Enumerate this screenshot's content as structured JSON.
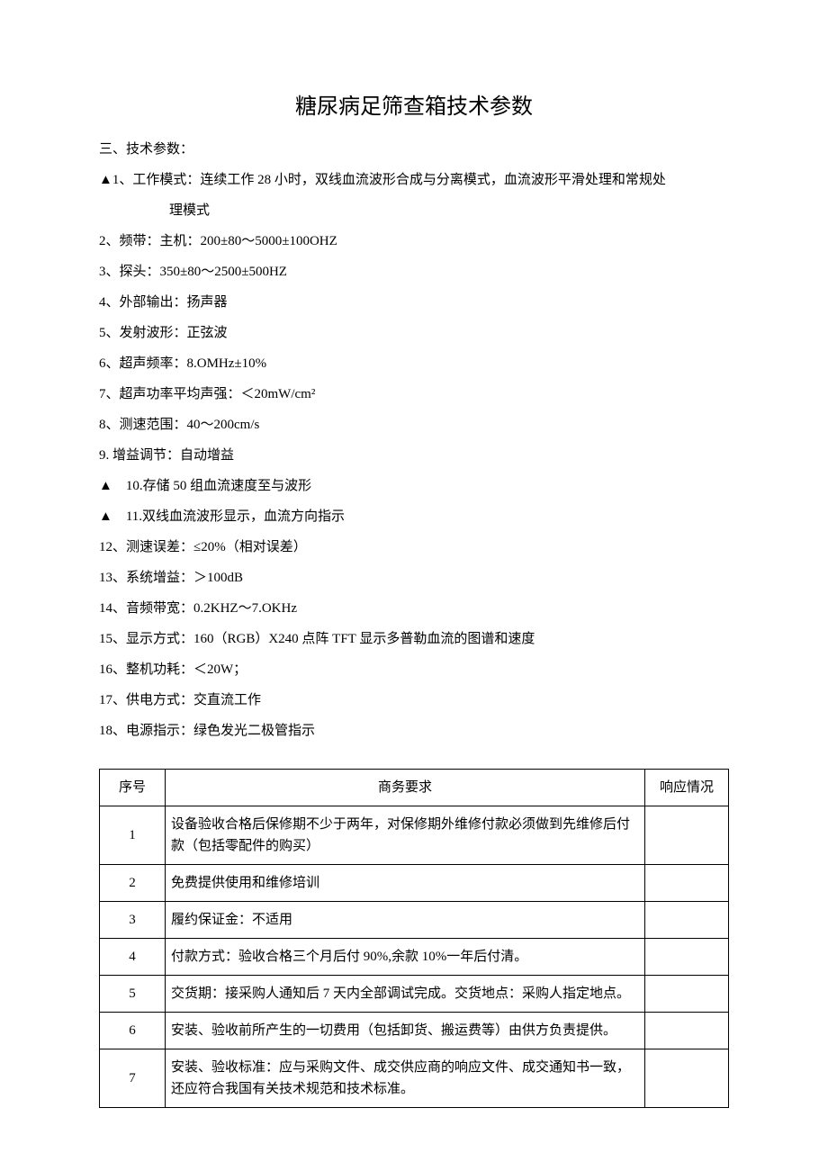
{
  "title": "糖尿病足筛查箱技术参数",
  "section_label": "三、技术参数：",
  "specs": [
    "▲1、工作模式：连续工作 28 小时，双线血流波形合成与分离模式，血流波形平滑处理和常规处",
    "理模式",
    "2、频带：主机：200±80～5000±100OHZ",
    "3、探头：350±80～2500±500HZ",
    "4、外部输出：扬声器",
    "5、发射波形：正弦波",
    "6、超声频率：8.OMHz±10%",
    "7、超声功率平均声强：＜20mW/cm²",
    "8、测速范围：40～200cm/s",
    "9. 增益调节：自动增益",
    "▲　10.存储 50 组血流速度至与波形",
    "▲　11.双线血流波形显示，血流方向指示",
    "12、测速误差：≤20%（相对误差）",
    "13、系统增益：＞100dB",
    "14、音频带宽：0.2KHZ～7.OKHz",
    "15、显示方式：160（RGB）X240 点阵 TFT 显示多普勒血流的图谱和速度",
    "16、整机功耗：＜20W；",
    "17、供电方式：交直流工作",
    "18、电源指示：绿色发光二极管指示"
  ],
  "spec_indent": [
    false,
    true,
    false,
    false,
    false,
    false,
    false,
    false,
    false,
    false,
    false,
    false,
    false,
    false,
    false,
    false,
    false,
    false,
    false
  ],
  "table": {
    "headers": [
      "序号",
      "商务要求",
      "响应情况"
    ],
    "rows": [
      {
        "num": "1",
        "req": "设备验收合格后保修期不少于两年，对保修期外维修付款必须做到先维修后付款（包括零配件的购买）",
        "resp": ""
      },
      {
        "num": "2",
        "req": "免费提供使用和维修培训",
        "resp": ""
      },
      {
        "num": "3",
        "req": "履约保证金：不适用",
        "resp": ""
      },
      {
        "num": "4",
        "req": "付款方式：验收合格三个月后付 90%,余款 10%一年后付清。",
        "resp": ""
      },
      {
        "num": "5",
        "req": "交货期：接采购人通知后 7 天内全部调试完成。交货地点：采购人指定地点。",
        "resp": ""
      },
      {
        "num": "6",
        "req": "安装、验收前所产生的一切费用（包括卸货、搬运费等）由供方负责提供。",
        "resp": ""
      },
      {
        "num": "7",
        "req": "安装、验收标准：应与采购文件、成交供应商的响应文件、成交通知书一致，还应符合我国有关技术规范和技术标准。",
        "resp": ""
      }
    ]
  }
}
